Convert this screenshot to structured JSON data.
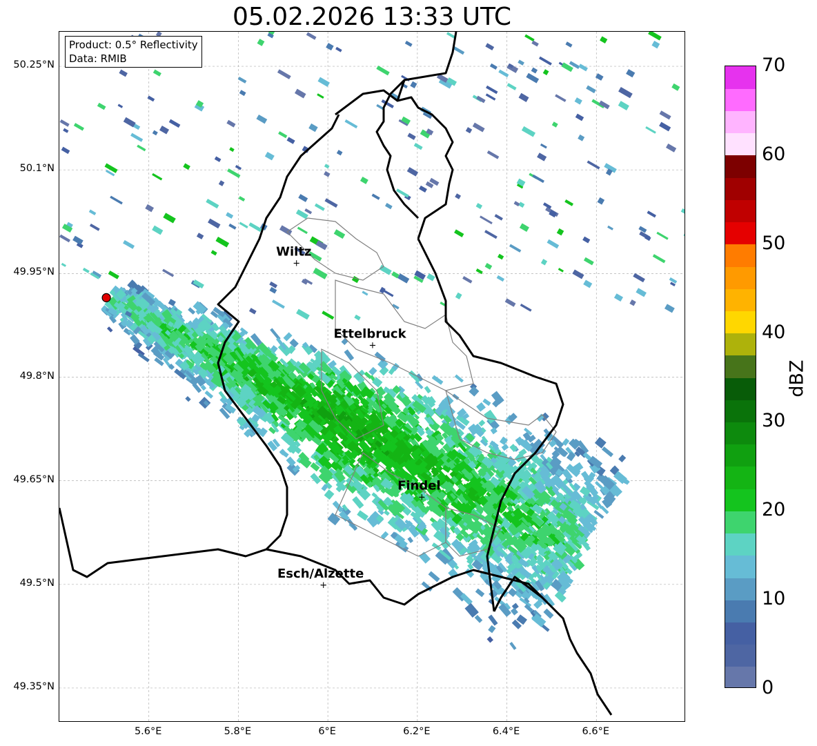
{
  "title": "05.02.2026 13:33 UTC",
  "info_box": {
    "product": "Product: 0.5° Reflectivity",
    "data_source": "Data: RMIB"
  },
  "map": {
    "lon_range": [
      5.4,
      6.8
    ],
    "lat_range": [
      49.3,
      50.3
    ],
    "lat_ticks": [
      {
        "label": "50.25°N",
        "value": 50.25
      },
      {
        "label": "50.1°N",
        "value": 50.1
      },
      {
        "label": "49.95°N",
        "value": 49.95
      },
      {
        "label": "49.8°N",
        "value": 49.8
      },
      {
        "label": "49.65°N",
        "value": 49.65
      },
      {
        "label": "49.5°N",
        "value": 49.5
      },
      {
        "label": "49.35°N",
        "value": 49.35
      }
    ],
    "lon_ticks": [
      {
        "label": "5.6°E",
        "value": 5.6
      },
      {
        "label": "5.8°E",
        "value": 5.8
      },
      {
        "label": "6°E",
        "value": 6.0
      },
      {
        "label": "6.2°E",
        "value": 6.2
      },
      {
        "label": "6.4°E",
        "value": 6.4
      },
      {
        "label": "6.6°E",
        "value": 6.6
      }
    ],
    "radar_site": {
      "lon": 5.505,
      "lat": 49.915,
      "color": "#e00000"
    },
    "cities": [
      {
        "name": "Wiltz",
        "lon": 5.93,
        "lat": 49.966
      },
      {
        "name": "Ettelbruck",
        "lon": 6.1,
        "lat": 49.847
      },
      {
        "name": "Findel",
        "lon": 6.21,
        "lat": 49.627
      },
      {
        "name": "Esch/Alzette",
        "lon": 5.99,
        "lat": 49.5
      }
    ],
    "border_color": "#000000",
    "canton_color": "#808080"
  },
  "colorbar": {
    "label": "dBZ",
    "min": 0,
    "max": 70,
    "ticks": [
      {
        "label": "0",
        "value": 0
      },
      {
        "label": "10",
        "value": 10
      },
      {
        "label": "20",
        "value": 20
      },
      {
        "label": "30",
        "value": 30
      },
      {
        "label": "40",
        "value": 40
      },
      {
        "label": "50",
        "value": 50
      },
      {
        "label": "60",
        "value": 60
      },
      {
        "label": "70",
        "value": 70
      }
    ],
    "colors": [
      "#6677aa",
      "#4e66a3",
      "#4560a3",
      "#4a7bb0",
      "#5a9cc4",
      "#66bcd6",
      "#5dd3c3",
      "#3ed46e",
      "#14c41e",
      "#14b414",
      "#10a010",
      "#0d8a0d",
      "#0a730a",
      "#085c08",
      "#47741a",
      "#aeb20b",
      "#ffd700",
      "#ffb300",
      "#ff9a00",
      "#ff7c00",
      "#e50000",
      "#c00000",
      "#a00000",
      "#7d0000",
      "#ffe1ff",
      "#ffb4ff",
      "#ff6bff",
      "#e632ee"
    ]
  }
}
